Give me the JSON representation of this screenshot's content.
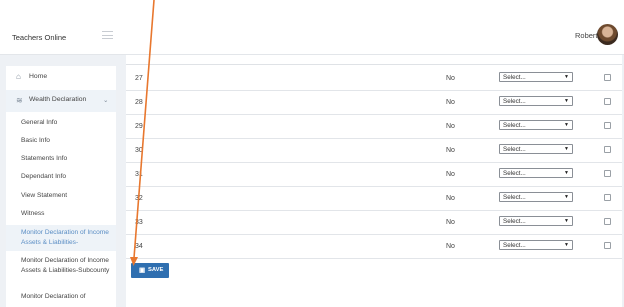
{
  "header": {
    "brand": "Teachers Online",
    "user_name": "Robert"
  },
  "sidebar": {
    "home": "Home",
    "wealth": "Wealth Declaration",
    "subitems": [
      {
        "label": "General Info"
      },
      {
        "label": "Basic Info"
      },
      {
        "label": "Statements Info"
      },
      {
        "label": "Dependant Info"
      },
      {
        "label": "View Statement"
      },
      {
        "label": "Witness"
      },
      {
        "label": "Monitor Declaration of Income Assets & Liabilities-"
      },
      {
        "label": "Monitor Declaration of Income Assets & Liabilities-Subcounty"
      },
      {
        "label": "Monitor Declaration of"
      }
    ]
  },
  "table": {
    "rows": [
      {
        "num": "27",
        "answer": "No",
        "select": "Select..."
      },
      {
        "num": "28",
        "answer": "No",
        "select": "Select..."
      },
      {
        "num": "29",
        "answer": "No",
        "select": "Select..."
      },
      {
        "num": "30",
        "answer": "No",
        "select": "Select..."
      },
      {
        "num": "31",
        "answer": "No",
        "select": "Select..."
      },
      {
        "num": "32",
        "answer": "No",
        "select": "Select..."
      },
      {
        "num": "33",
        "answer": "No",
        "select": "Select..."
      },
      {
        "num": "34",
        "answer": "No",
        "select": "Select..."
      }
    ]
  },
  "actions": {
    "save": "SAVE"
  },
  "icons": {
    "home": "home-icon",
    "wealth": "layers-icon",
    "chevron": "chevron-down-icon",
    "menu": "hamburger-icon",
    "save": "floppy-disk-icon",
    "select_arrow": "caret-down-icon",
    "annotation": "orange-arrow-annotation"
  },
  "colors": {
    "accent": "#2f6fb0",
    "annotation": "#e8772e",
    "active_link": "#5a8dc4"
  }
}
